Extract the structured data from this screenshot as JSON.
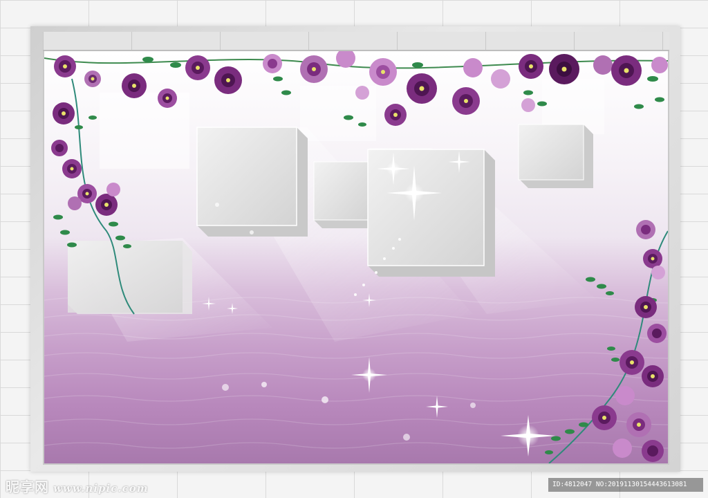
{
  "watermark": {
    "logo_text": "昵享网",
    "site": "www.nipic.com",
    "id_text": "ID:4812047 NO:20191130154443613081"
  },
  "colors": {
    "flower_dark": "#5a1a5e",
    "flower_mid": "#8a3a8e",
    "flower_light": "#c98acb",
    "leaf": "#2f8a4a",
    "water_top": "#d9bedb",
    "water_bottom": "#a879ad"
  }
}
